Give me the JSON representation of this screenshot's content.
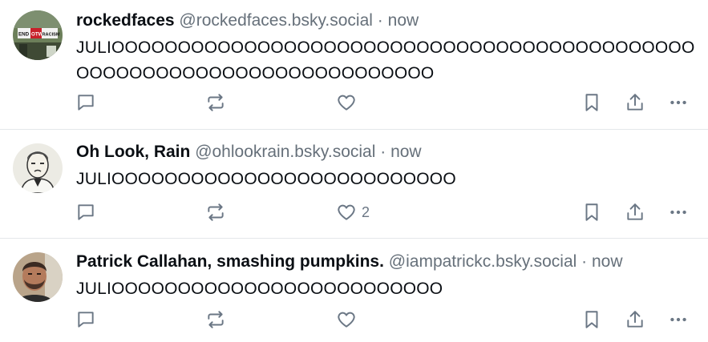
{
  "posts": [
    {
      "display_name": "rockedfaces",
      "handle": "@rockedfaces.bsky.social",
      "separator": "·",
      "time": "now",
      "text": "JULIOOOOOOOOOOOOOOOOOOOOOOOOOOOOOOOOOOOOOOOOOOOOOOOOOOOOOOOOOOOOOOOOOOOOOOO",
      "like_count": "",
      "avatar_sign_text": [
        "END",
        "OTW",
        "RACISM"
      ]
    },
    {
      "display_name": "Oh Look, Rain",
      "handle": "@ohlookrain.bsky.social",
      "separator": "·",
      "time": "now",
      "text": "JULIOOOOOOOOOOOOOOOOOOOOOOOOOO",
      "like_count": "2"
    },
    {
      "display_name": "Patrick Callahan, smashing pumpkins.",
      "handle": "@iampatrickc.bsky.social",
      "separator": "·",
      "time": "now",
      "text": "JULIOOOOOOOOOOOOOOOOOOOOOOOOO",
      "like_count": ""
    }
  ],
  "icons": {
    "reply": "reply-icon",
    "repost": "repost-icon",
    "like": "heart-icon",
    "bookmark": "bookmark-icon",
    "share": "share-icon",
    "more": "more-icon"
  },
  "colors": {
    "text": "#0b0f14",
    "muted": "#66707a",
    "icon": "#6b7785",
    "divider": "#e4e7ea"
  }
}
